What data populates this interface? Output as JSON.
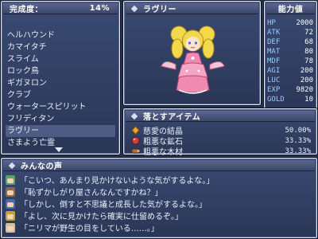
{
  "list_window": {
    "completion_label": "完成度：",
    "completion_value": "14%",
    "enemies": [
      "ヘルハウンド",
      "カマイタチ",
      "スライム",
      "ロック鳥",
      "ギガヌロン",
      "クラブ",
      "ウォータースピリット",
      "フリディタン",
      "ラヴリー",
      "さまよう亡霊"
    ],
    "selected_index": 8
  },
  "portrait_window": {
    "name": "ラヴリー"
  },
  "stats_window": {
    "title": "能力値",
    "stats": [
      {
        "name": "HP",
        "value": "2000"
      },
      {
        "name": "ATK",
        "value": "72"
      },
      {
        "name": "DEF",
        "value": "68"
      },
      {
        "name": "MAT",
        "value": "80"
      },
      {
        "name": "MDF",
        "value": "78"
      },
      {
        "name": "AGI",
        "value": "200"
      },
      {
        "name": "LUC",
        "value": "200"
      },
      {
        "name": "EXP",
        "value": "9820"
      },
      {
        "name": "GOLD",
        "value": "10"
      }
    ]
  },
  "drops_window": {
    "title": "落とすアイテム",
    "items": [
      {
        "name": "慈愛の結晶",
        "rate": "50.00%",
        "icon": "orange-crystal-icon",
        "color": "#f0a030"
      },
      {
        "name": "粗悪な鉱石",
        "rate": "33.33%",
        "icon": "red-ore-icon",
        "color": "#d04040"
      },
      {
        "name": "粗悪な木材",
        "rate": "33.33%",
        "icon": "wood-log-icon",
        "color": "#b07040"
      }
    ]
  },
  "voices_window": {
    "title": "みんなの声",
    "voices": [
      {
        "text": "「こいつ、あんまり見かけないような気がするよな。」",
        "face_color": "#5aa06a"
      },
      {
        "text": "「恥ずかしがり屋さんなんですかね？」",
        "face_color": "#8a6a4a"
      },
      {
        "text": "「しかし、倒すと不思議と成長した気がするよな。」",
        "face_color": "#4a6ab0"
      },
      {
        "text": "「よし、次に見かけたら確実に仕留めるぞ。」",
        "face_color": "#c0a040"
      },
      {
        "text": "「ニリマが野生の目をしている……。」",
        "face_color": "#d0c0a0"
      }
    ]
  }
}
